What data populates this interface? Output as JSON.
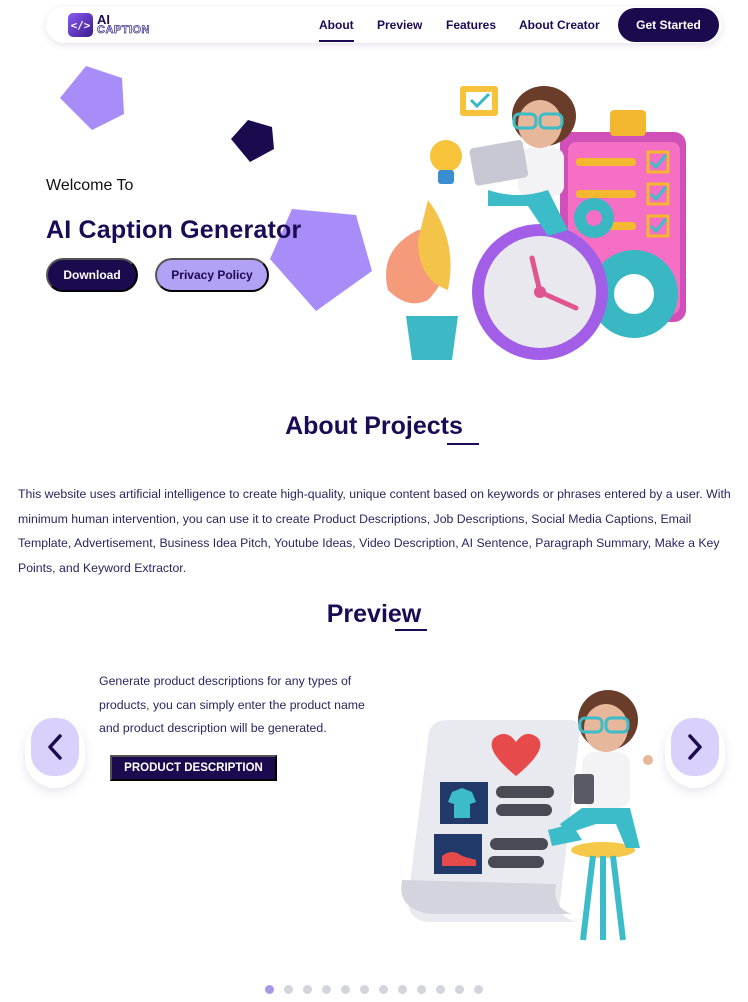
{
  "brand": {
    "logo_glyph": "</>",
    "logo_line1": "AI",
    "logo_line2": "CAPTION"
  },
  "nav": {
    "links": [
      {
        "label": "About",
        "active": true
      },
      {
        "label": "Preview",
        "active": false
      },
      {
        "label": "Features",
        "active": false
      },
      {
        "label": "About Creator",
        "active": false
      }
    ],
    "cta_label": "Get Started"
  },
  "hero": {
    "welcome": "Welcome To",
    "title": "AI Caption Generator",
    "download_label": "Download",
    "privacy_label": "Privacy Policy",
    "illustration_icon": "developer-at-clock-and-checklist-illustration"
  },
  "about": {
    "title": "About Projects",
    "body": "This website uses artificial intelligence to create high-quality, unique content based on keywords or phrases entered by a user. With minimum human intervention, you can use it to create Product Descriptions, Job Descriptions, Social Media Captions, Email Template, Advertisement, Business Idea Pitch, Youtube Ideas, Video Description, AI Sentence, Paragraph Summary, Make a Key Points, and Keyword Extractor."
  },
  "preview": {
    "title": "Preview",
    "prev_icon": "chevron-left-icon",
    "next_icon": "chevron-right-icon",
    "slide": {
      "text": "Generate product descriptions for any types of products, you can simply enter the product name and product description will be generated.",
      "button_label": "PRODUCT DESCRIPTION",
      "illustration_icon": "girl-with-product-list-illustration"
    },
    "dots_total": 12,
    "active_dot": 0
  },
  "colors": {
    "primary_dark": "#1c0a4f",
    "accent_light": "#b3a1f5",
    "pentagon_light": "#a88cf7",
    "pentagon_dark": "#1c0a4f"
  }
}
